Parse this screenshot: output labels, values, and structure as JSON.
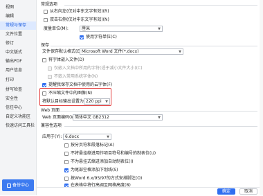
{
  "sidebar": {
    "items": [
      {
        "label": "视图",
        "active": false
      },
      {
        "label": "编辑",
        "active": false
      },
      {
        "label": "常规与保存",
        "active": true
      },
      {
        "label": "文件位置",
        "active": false
      },
      {
        "label": "修订",
        "active": false
      },
      {
        "label": "中文版式",
        "active": false
      },
      {
        "label": "输出PDF",
        "active": false
      },
      {
        "label": "用户信息",
        "active": false
      },
      {
        "label": "打印",
        "active": false
      },
      {
        "label": "拼写检查",
        "active": false
      },
      {
        "label": "安全性",
        "active": false
      },
      {
        "label": "信任中心",
        "active": false
      },
      {
        "label": "自定义功能区",
        "active": false
      },
      {
        "label": "快速访问工具栏",
        "active": false
      }
    ],
    "backup_label": "备份中心"
  },
  "general": {
    "title": "常规选项",
    "opt1": "从右向左(仅对中东文字有效)(R)",
    "opt2": "双击右侧(仅对中东文字有效)(N)",
    "unit_label": "度量单位(M):",
    "unit_value": "厘米",
    "char_unit": "使用字符单位(C)"
  },
  "save": {
    "title": "保存",
    "format_label": "文件保存默认格式(E):",
    "format_value": "Microsoft Word 文件(*.docx)",
    "embed_fonts": "将字体嵌入文件(D)",
    "embed_sub1": "仅嵌入文档中所用的字符(适于减小文件大小)(C)",
    "embed_sub2": "不嵌入常用系统字体(N)",
    "remind_fonts": "提醒我保存文档中使用的云字体(F)",
    "no_compress": "不压缩文件中的图像(N)",
    "dpi_label": "将默认目标输出设置为(T):",
    "dpi_value": "220 ppi"
  },
  "web": {
    "title": "Web 页面",
    "encoding_label": "Web 页面编码(W):",
    "encoding_value": "简体中文 GB2312"
  },
  "compat": {
    "title": "兼容性选项",
    "apply_label": "应用于(Y):",
    "apply_value": "6.docx",
    "items": [
      {
        "label": "按分页符和段落标记(A)",
        "checked": false
      },
      {
        "label": "不将悬挂缩进用作项目符号和编号的制表位(U)",
        "checked": false
      },
      {
        "label": "不为悬挂式缩进添加自动制表位(I)",
        "checked": false
      },
      {
        "label": "为尾部空格添加下划线(S)",
        "checked": true
      },
      {
        "label": "按Word 6.x/95/97的方式安排脚注(O)",
        "checked": false
      },
      {
        "label": "在表格中将行高调至网格高度(B)",
        "checked": true
      }
    ]
  },
  "buttons": {
    "ok": "确定",
    "cancel": "取消"
  }
}
